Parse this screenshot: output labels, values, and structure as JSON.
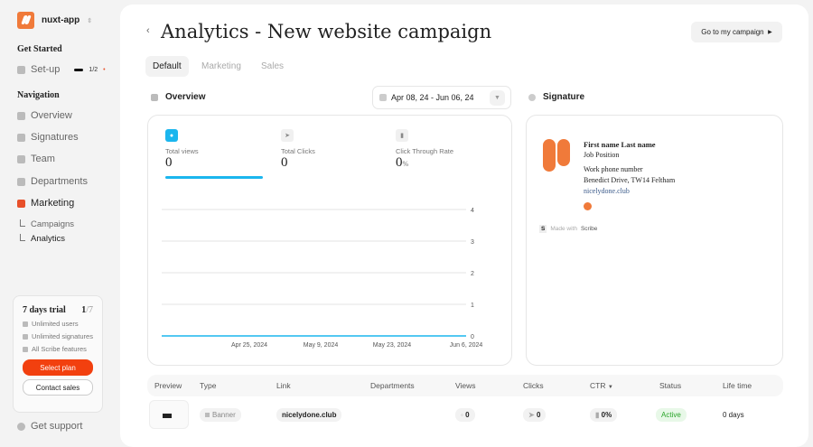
{
  "sidebar": {
    "app": "nuxt-app",
    "get_started": "Get Started",
    "setup": "Set-up",
    "setup_progress": "1/2",
    "navigation": "Navigation",
    "items": [
      {
        "label": "Overview"
      },
      {
        "label": "Signatures"
      },
      {
        "label": "Team"
      },
      {
        "label": "Departments"
      },
      {
        "label": "Marketing"
      }
    ],
    "sub": [
      {
        "label": "Campaigns"
      },
      {
        "label": "Analytics"
      }
    ],
    "trial": {
      "title": "7 days trial",
      "count": "1",
      "total": "/7",
      "features": [
        "Unlimited users",
        "Unlimited signatures",
        "All Scribe features"
      ],
      "select": "Select plan",
      "contact": "Contact sales"
    },
    "support": "Get support"
  },
  "header": {
    "title": "Analytics - New website campaign",
    "go": "Go to my campaign"
  },
  "tabs": [
    "Default",
    "Marketing",
    "Sales"
  ],
  "overview": {
    "label": "Overview",
    "date": "Apr 08, 24 - Jun 06, 24",
    "metrics": [
      {
        "label": "Total views",
        "value": "0"
      },
      {
        "label": "Total Clicks",
        "value": "0"
      },
      {
        "label": "Click Through Rate",
        "value": "0",
        "unit": "%"
      }
    ]
  },
  "signature": {
    "label": "Signature",
    "name": "First name Last name",
    "position": "Job Position",
    "phone": "Work phone number",
    "address": "Benedict Drive, TW14 Feltham",
    "site": "nicelydone.club",
    "made": "Made with",
    "scribe": "Scribe"
  },
  "chart_data": {
    "type": "line",
    "x": [
      "Apr 25, 2024",
      "May 9, 2024",
      "May 23, 2024",
      "Jun 6, 2024"
    ],
    "y_ticks": [
      "4",
      "3",
      "2",
      "1",
      "0"
    ],
    "ylim": [
      0,
      4
    ],
    "series": [
      {
        "name": "Total views",
        "values": [
          0,
          0,
          0,
          0
        ],
        "color": "#1bb6ee"
      }
    ]
  },
  "table": {
    "headers": [
      "Preview",
      "Type",
      "Link",
      "Departments",
      "Views",
      "Clicks",
      "CTR",
      "Status",
      "Life time"
    ],
    "rows": [
      {
        "type": "Banner",
        "link": "nicelydone.club",
        "views": "0",
        "clicks": "0",
        "ctr": "0%",
        "status": "Active",
        "life": "0 days"
      }
    ]
  }
}
